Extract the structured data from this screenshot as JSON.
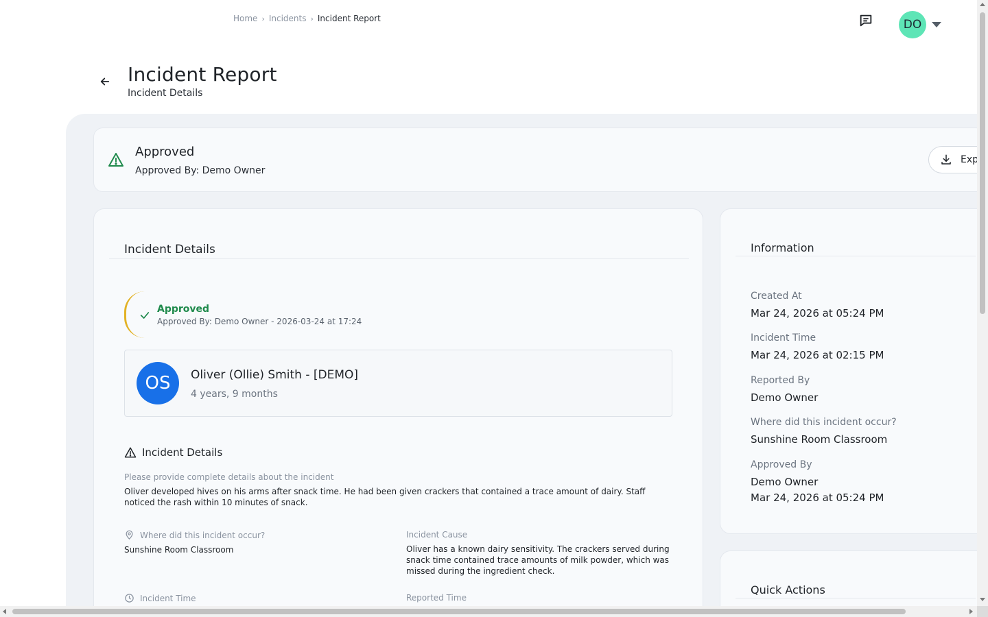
{
  "breadcrumb": {
    "items": [
      "Home",
      "Incidents"
    ],
    "current": "Incident Report"
  },
  "user": {
    "initials": "DO"
  },
  "page": {
    "title": "Incident Report",
    "subtitle": "Incident Details"
  },
  "status": {
    "title": "Approved",
    "approved_by": "Approved By: Demo Owner",
    "export_label": "Exp"
  },
  "details_card": {
    "title": "Incident Details",
    "approval": {
      "title": "Approved",
      "subtitle": "Approved By: Demo Owner - 2026-03-24 at 17:24"
    },
    "child": {
      "initials": "OS",
      "name": "Oliver (Ollie) Smith - [DEMO]",
      "age": "4 years, 9 months"
    },
    "section_title": "Incident Details",
    "fields": {
      "details_label": "Please provide complete details about the incident",
      "details_value": "Oliver developed hives on his arms after snack time. He had been given crackers that contained a trace amount of dairy. Staff noticed the rash within 10 minutes of snack.",
      "location_label": "Where did this incident occur?",
      "location_value": "Sunshine Room Classroom",
      "cause_label": "Incident Cause",
      "cause_value": "Oliver has a known dairy sensitivity. The crackers served during snack time contained trace amounts of milk powder, which was missed during the ingredient check.",
      "time_label": "Incident Time",
      "reported_label": "Reported Time"
    }
  },
  "info_card": {
    "title": "Information",
    "created_label": "Created At",
    "created_value": "Mar 24, 2026 at 05:24 PM",
    "time_label": "Incident Time",
    "time_value": "Mar 24, 2026 at 02:15 PM",
    "reported_label": "Reported By",
    "reported_value": "Demo Owner",
    "where_label": "Where did this incident occur?",
    "where_value": "Sunshine Room Classroom",
    "approved_label": "Approved By",
    "approved_value": "Demo Owner",
    "approved_time": "Mar 24, 2026 at 05:24 PM"
  },
  "quick_actions": {
    "title": "Quick Actions"
  },
  "colors": {
    "approved_green": "#1f8a4c",
    "arc_yellow": "#e2b226",
    "avatar_teal": "#5ee5b6",
    "child_avatar_blue": "#1870e8"
  },
  "icons": [
    "chat-icon",
    "chevron-right-icon",
    "back-arrow-icon",
    "warning-icon",
    "download-icon",
    "check-icon",
    "location-pin-icon",
    "clock-icon"
  ]
}
